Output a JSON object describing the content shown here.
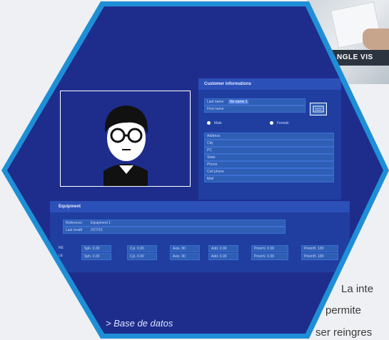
{
  "caption": "> Base de datos",
  "customer_panel": {
    "title": "Customer informations",
    "last_name_label": "Last name",
    "last_name_value": "No name 1",
    "first_name_label": "First name",
    "gender_male": "Male",
    "gender_female": "Female",
    "fields": [
      "Address",
      "City",
      "PC",
      "State",
      "Phone",
      "Cell phone",
      "Mail"
    ]
  },
  "equipment_panel": {
    "title": "Equipment",
    "reference_label": "Reference",
    "reference_value": "Equipment 1",
    "last_modif_label": "Last modif",
    "last_modif_value": "2/27/15",
    "rows": [
      {
        "eye": "RE",
        "sph": "Sph. 0.00",
        "cyl": "Cyl. 0.00",
        "axis": "Axis. 90",
        "add": "Add. 0.00",
        "prism_v": "PrismV. 0.00",
        "prism_h": "PrismH. 180"
      },
      {
        "eye": "LE",
        "sph": "Sph. 0.00",
        "cyl": "Cyl. 0.00",
        "axis": "Axis. 90",
        "add": "Add. 0.00",
        "prism_v": "PrismV. 0.00",
        "prism_h": "PrismH. 180"
      }
    ]
  },
  "background_banner": "NGLE VIS",
  "side_text": {
    "line1": "La inte",
    "line2": "permite",
    "line3": "ser reingres"
  },
  "colors": {
    "hex_border": "#1e8fd6",
    "screen_bg": "#1e2d8c",
    "field_bg": "#2f5eb5"
  }
}
